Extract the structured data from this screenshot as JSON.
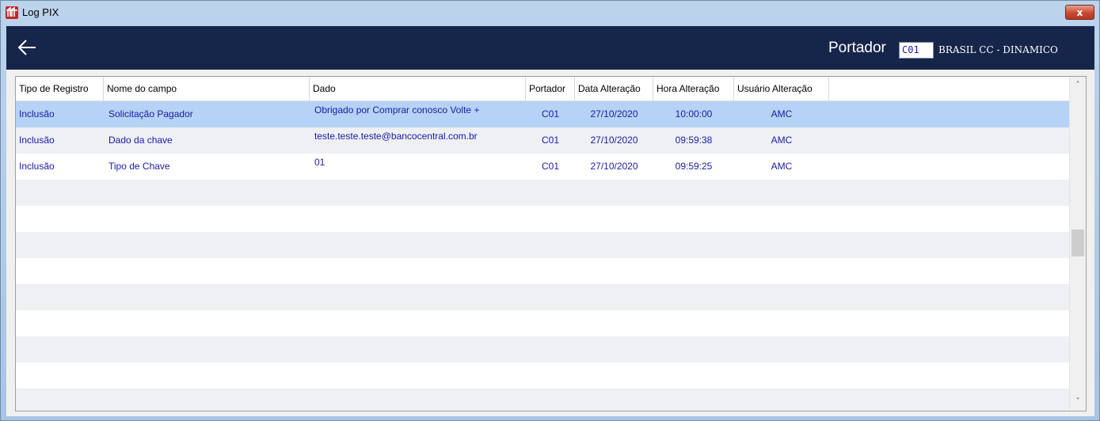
{
  "window": {
    "title": "Log PIX",
    "close_label": "x"
  },
  "header": {
    "portador_label": "Portador",
    "portador_code": "C01",
    "portador_name": "BRASIL CC - DINAMICO"
  },
  "grid": {
    "columns": [
      "Tipo de Registro",
      "Nome do campo",
      "Dado",
      "Portador",
      "Data Alteração",
      "Hora Alteração",
      "Usuário Alteração"
    ],
    "rows": [
      [
        "Inclusão",
        "Solicitação Pagador",
        "Obrigado por Comprar conosco Volte +",
        "C01",
        "27/10/2020",
        "10:00:00",
        "AMC"
      ],
      [
        "Inclusão",
        "Dado da chave",
        "teste.teste.teste@bancocentral.com.br",
        "C01",
        "27/10/2020",
        "09:59:38",
        "AMC"
      ],
      [
        "Inclusão",
        "Tipo de Chave",
        "01",
        "C01",
        "27/10/2020",
        "09:59:25",
        "AMC"
      ]
    ],
    "selected_row": 0,
    "scroll_up": "˄",
    "scroll_down": "˅"
  },
  "colors": {
    "header_bg": "#16254a",
    "selected_row": "#b6d3f5",
    "cell_text": "#1a1aa6"
  }
}
